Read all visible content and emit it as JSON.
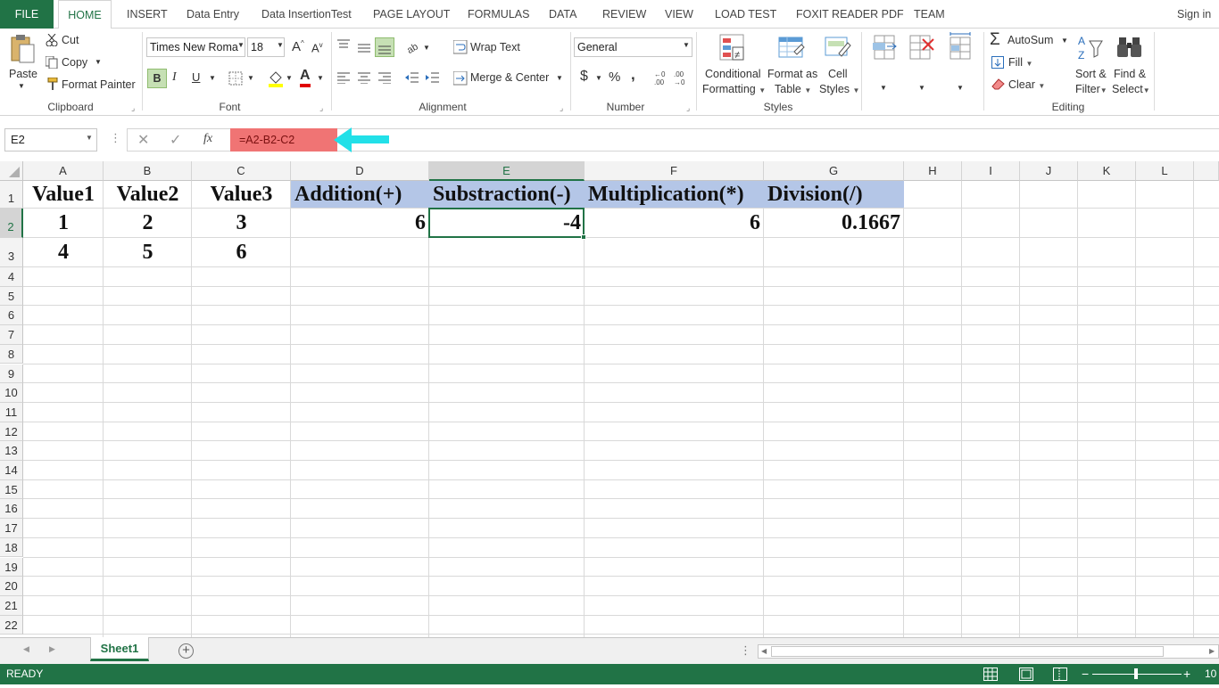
{
  "ribbon_tabs": {
    "file": "FILE",
    "home": "HOME",
    "insert": "INSERT",
    "data_entry": "Data Entry",
    "data_insertion_test": "Data InsertionTest",
    "page_layout": "PAGE LAYOUT",
    "formulas": "FORMULAS",
    "data": "DATA",
    "review": "REVIEW",
    "view": "VIEW",
    "load_test": "LOAD TEST",
    "foxit": "FOXIT READER PDF",
    "team": "TEAM",
    "sign_in": "Sign in"
  },
  "clipboard": {
    "paste": "Paste",
    "cut": "Cut",
    "copy": "Copy",
    "format_painter": "Format Painter",
    "label": "Clipboard"
  },
  "font": {
    "name": "Times New Roma",
    "size": "18",
    "grow": "A",
    "shrink": "A",
    "bold": "B",
    "italic": "I",
    "underline": "U",
    "color_letter": "A",
    "label": "Font"
  },
  "alignment": {
    "wrap_text": "Wrap Text",
    "merge_center": "Merge & Center",
    "label": "Alignment"
  },
  "number": {
    "format": "General",
    "currency": "$",
    "percent": "%",
    "comma": ",",
    "label": "Number"
  },
  "styles": {
    "conditional": "Conditional",
    "conditional2": "Formatting",
    "format_as": "Format as",
    "format_as2": "Table",
    "cell": "Cell",
    "cell2": "Styles",
    "label": "Styles"
  },
  "cells": {
    "A1": "Value1",
    "B1": "Value2",
    "C1": "Value3",
    "D1": "Addition(+)",
    "E1": "Substraction(-)",
    "F1": "Multiplication(*)",
    "G1": "Division(/)",
    "A2": "1",
    "B2": "2",
    "C2": "3",
    "D2": "6",
    "E2": "-4",
    "F2": "6",
    "G2": "0.1667",
    "A3": "4",
    "B3": "5",
    "C3": "6"
  },
  "editing": {
    "autosum": "AutoSum",
    "fill": "Fill",
    "clear": "Clear",
    "sort": "Sort &",
    "sort2": "Filter",
    "find": "Find &",
    "find2": "Select",
    "label": "Editing"
  },
  "formula_bar": {
    "name_box": "E2",
    "fx": "fx",
    "formula": "=A2-B2-C2"
  },
  "columns": [
    "A",
    "B",
    "C",
    "D",
    "E",
    "F",
    "G",
    "H",
    "I",
    "J",
    "K",
    "L"
  ],
  "rows": [
    "1",
    "2",
    "3",
    "4",
    "5",
    "6",
    "7",
    "8",
    "9",
    "10",
    "11",
    "12",
    "13",
    "14",
    "15",
    "16",
    "17",
    "18",
    "19",
    "20",
    "21",
    "22"
  ],
  "sheet": {
    "tab": "Sheet1",
    "add": "+"
  },
  "status": {
    "ready": "READY",
    "zoom": "10"
  },
  "colors": {
    "accent": "#217346",
    "header_fill": "#b4c6e7",
    "formula_highlight": "#f07474",
    "arrow": "#22e0e8"
  }
}
